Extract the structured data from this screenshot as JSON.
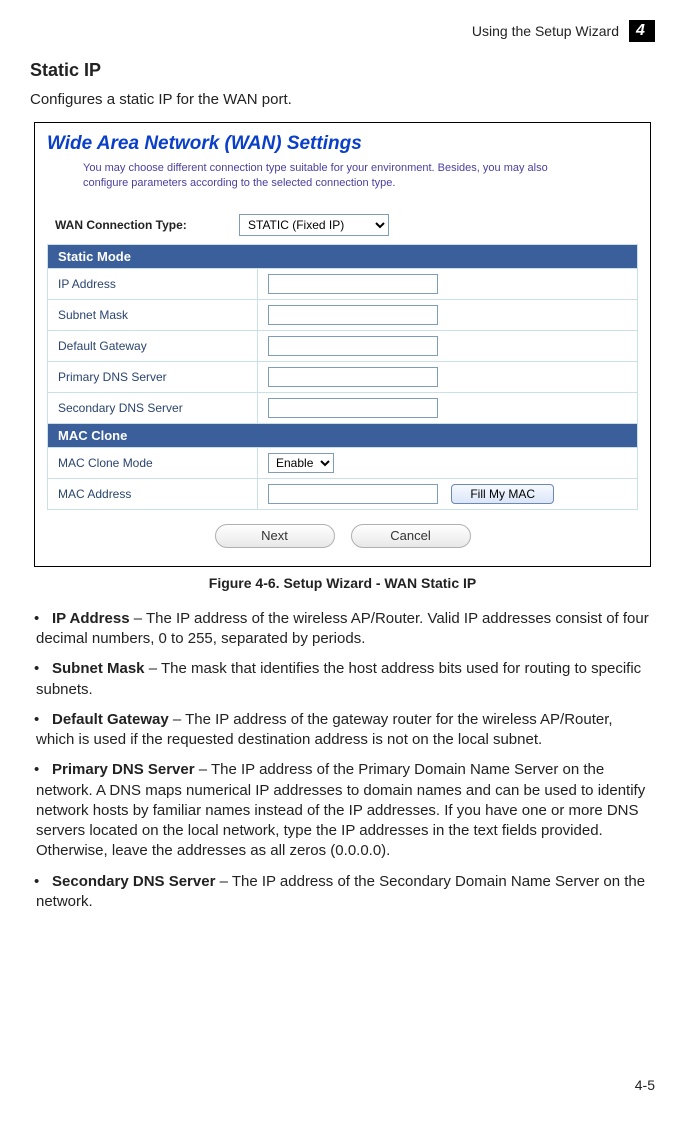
{
  "header": {
    "breadcrumb": "Using the Setup Wizard",
    "chapter": "4"
  },
  "section": {
    "title": "Static IP",
    "lead": "Configures a static IP for the WAN port."
  },
  "wan": {
    "title": "Wide Area Network (WAN) Settings",
    "desc": "You may choose different connection type suitable for your environment. Besides, you may also configure parameters according to the selected connection type.",
    "conn_label": "WAN Connection Type:",
    "conn_value": "STATIC (Fixed IP)",
    "static_mode_header": "Static Mode",
    "rows": {
      "ip_address": "IP Address",
      "subnet_mask": "Subnet Mask",
      "default_gateway": "Default Gateway",
      "primary_dns": "Primary DNS Server",
      "secondary_dns": "Secondary DNS Server"
    },
    "mac_clone_header": "MAC Clone",
    "mac_rows": {
      "mac_clone_mode_label": "MAC Clone Mode",
      "mac_clone_mode_value": "Enable",
      "mac_address_label": "MAC Address",
      "fill_my_mac": "Fill My MAC"
    },
    "buttons": {
      "next": "Next",
      "cancel": "Cancel"
    }
  },
  "figure_caption": "Figure 4-6.   Setup Wizard - WAN Static IP",
  "bullets": [
    {
      "term": "IP Address",
      "text": " – The IP address of the wireless AP/Router. Valid IP addresses consist of four decimal numbers, 0 to 255, separated by periods."
    },
    {
      "term": "Subnet Mask",
      "text": " – The mask that identifies the host address bits used for routing to specific subnets."
    },
    {
      "term": "Default Gateway",
      "text": " – The IP address of the gateway router for the wireless AP/Router, which is used if the requested destination address is not on the local subnet."
    },
    {
      "term": "Primary DNS Server",
      "text": " – The IP address of the Primary Domain Name Server on the network. A DNS maps numerical IP addresses to domain names and can be used to identify network hosts by familiar names instead of the IP addresses. If you have one or more DNS servers located on the local network, type the IP addresses in the text fields provided. Otherwise, leave the addresses as all zeros (0.0.0.0)."
    },
    {
      "term": "Secondary DNS Server",
      "text": " – The IP address of the Secondary Domain Name Server on the network."
    }
  ],
  "page_number": "4-5"
}
